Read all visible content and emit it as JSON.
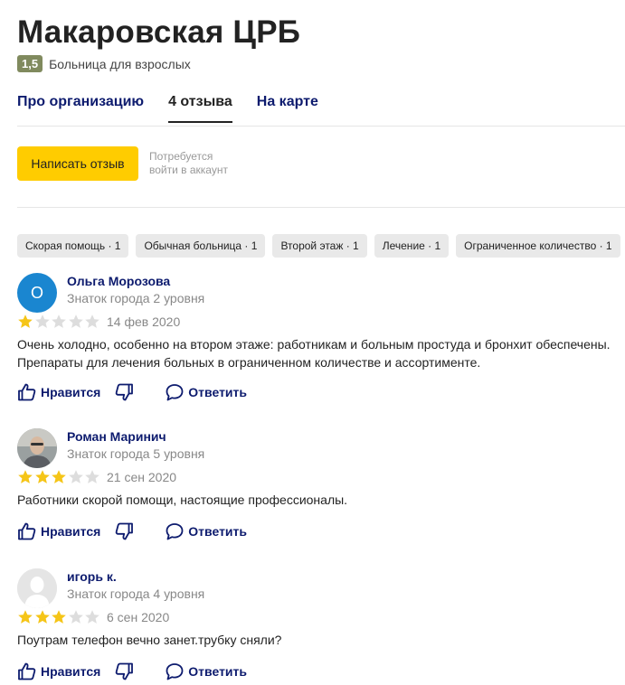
{
  "org": {
    "title": "Макаровская ЦРБ",
    "rating": "1,5",
    "category": "Больница для взрослых"
  },
  "tabs": [
    {
      "label": "Про организацию",
      "active": false
    },
    {
      "label": "4 отзыва",
      "active": true
    },
    {
      "label": "На карте",
      "active": false
    }
  ],
  "write_review": {
    "button_label": "Написать отзыв",
    "note_line1": "Потребуется",
    "note_line2": "войти в аккаунт"
  },
  "chips": [
    {
      "label": "Скорая помощь · 1"
    },
    {
      "label": "Обычная больница · 1"
    },
    {
      "label": "Второй этаж · 1"
    },
    {
      "label": "Лечение · 1"
    },
    {
      "label": "Ограниченное количество · 1"
    }
  ],
  "actions": {
    "like_label": "Нравится",
    "reply_label": "Ответить"
  },
  "reviews": [
    {
      "author": "Ольга Морозова",
      "avatar_letter": "О",
      "level": "Знаток города 2 уровня",
      "stars": 1,
      "date": "14 фев 2020",
      "text_line1": "Очень холодно, особенно на втором этаже: работникам и больным простуда и бронхит обеспечены.",
      "text_line2": "Препараты для лечения больных в ограниченном количестве и ассортименте."
    },
    {
      "author": "Роман Маринич",
      "level": "Знаток города 5 уровня",
      "stars": 3,
      "date": "21 сен 2020",
      "text_line1": "Работники скорой помощи, настоящие профессионалы."
    },
    {
      "author": "игорь к.",
      "level": "Знаток города 4 уровня",
      "stars": 3,
      "date": "6 сен 2020",
      "text_line1": "Поутрам телефон вечно занет.трубку сняли?"
    }
  ],
  "colors": {
    "star_filled": "#f5c518",
    "star_empty": "#dddddd",
    "link": "#0d1b6e",
    "write_button": "#ffcc00",
    "rating_badge": "#808a5e"
  }
}
